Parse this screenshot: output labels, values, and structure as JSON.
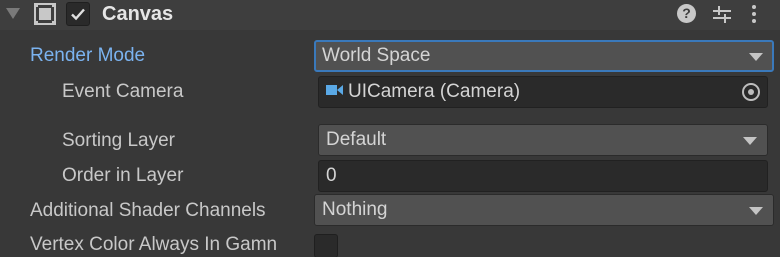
{
  "component": {
    "title": "Canvas",
    "enabled": true,
    "header_icons": [
      "help-icon",
      "preset-sliders-icon",
      "context-menu-icon"
    ]
  },
  "properties": {
    "render_mode": {
      "label": "Render Mode",
      "value": "World Space"
    },
    "event_camera": {
      "label": "Event Camera",
      "value": "UICamera (Camera)"
    },
    "sorting_layer": {
      "label": "Sorting Layer",
      "value": "Default"
    },
    "order_in_layer": {
      "label": "Order in Layer",
      "value": "0"
    },
    "additional_shader_channels": {
      "label": "Additional Shader Channels",
      "value": "Nothing"
    },
    "vertex_color_always_in_gamma": {
      "label": "Vertex Color Always In Gamn",
      "checked": false
    }
  },
  "colors": {
    "highlight_label": "#7bb3f0",
    "focus_border": "#3a79bb",
    "camera_icon": "#5aa9e6"
  }
}
